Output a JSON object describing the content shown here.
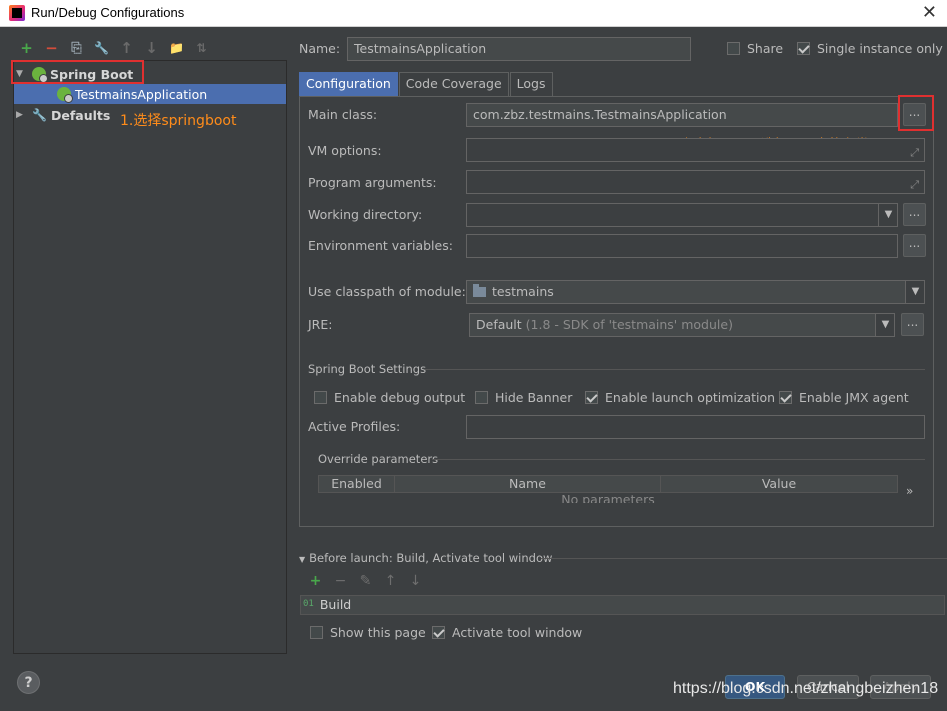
{
  "window": {
    "title": "Run/Debug Configurations",
    "close_glyph": "✕"
  },
  "left": {
    "toolbar": [
      "+",
      "−",
      "⎘",
      "🔧",
      "↑",
      "↓",
      "📁",
      "⇅"
    ],
    "tree": [
      {
        "label": "Spring Boot"
      },
      {
        "label": "TestmainsApplication"
      },
      {
        "label": "Defaults"
      }
    ]
  },
  "annotations": {
    "step1": "1.选择springboot",
    "step2": "2.点击打开可以选择项目中的主类"
  },
  "header": {
    "name_label": "Name:",
    "name_value": "TestmainsApplication",
    "share_label": "Share",
    "single_instance_label": "Single instance only"
  },
  "tabs": [
    "Configuration",
    "Code Coverage",
    "Logs"
  ],
  "config": {
    "main_class_label": "Main class:",
    "main_class_value": "com.zbz.testmains.TestmainsApplication",
    "vm_options_label": "VM options:",
    "program_arguments_label": "Program arguments:",
    "working_directory_label": "Working directory:",
    "environment_variables_label": "Environment variables:",
    "classpath_label": "Use classpath of module:",
    "classpath_value": "testmains",
    "jre_label": "JRE:",
    "jre_value_main": "Default",
    "jre_value_detail": " (1.8 - SDK of 'testmains' module)",
    "dots": "...",
    "dd": "▼"
  },
  "spring_boot": {
    "section_title": "Spring Boot Settings",
    "enable_debug_output": "Enable debug output",
    "hide_banner": "Hide Banner",
    "enable_launch_optimization": "Enable launch optimization",
    "enable_jmx_agent": "Enable JMX agent",
    "active_profiles_label": "Active Profiles:",
    "override_parameters_title": "Override parameters",
    "table_columns": [
      "Enabled",
      "Name",
      "Value"
    ],
    "table_empty": "No parameters",
    "more_glyph": "»"
  },
  "before_launch": {
    "title": "Before launch: Build, Activate tool window",
    "items": [
      "Build"
    ],
    "build_icon_text": "01",
    "show_this_page": "Show this page",
    "activate_tool_window": "Activate tool window"
  },
  "footer": {
    "help": "?",
    "ok": "OK",
    "cancel": "Cancel",
    "apply": "Apply"
  },
  "watermark": "https://blog.csdn.net/zhangbeizhen18",
  "colors": {
    "accent": "#4b6eaf",
    "annotation": "#ff8c1a",
    "highlight_box": "#e03030",
    "background": "#3c3f41"
  }
}
